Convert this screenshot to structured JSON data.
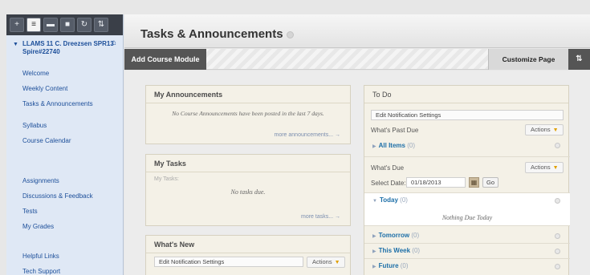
{
  "sidebar": {
    "toolbar_icons": [
      "plus-icon",
      "list-icon",
      "folder-icon",
      "card-icon",
      "refresh-icon",
      "sort-icon"
    ],
    "toolbar_glyphs": [
      "+",
      "≡",
      "▬",
      "■",
      "↻",
      "⇅"
    ],
    "course_title": "LLAMS 11 C. Dreezsen SPR13 Spire#22740",
    "items": [
      {
        "label": "Welcome"
      },
      {
        "label": "Weekly Content"
      },
      {
        "label": "Tasks & Announcements"
      },
      {
        "label": "Syllabus"
      },
      {
        "label": "Course Calendar"
      },
      {
        "label": "Assignments"
      },
      {
        "label": "Discussions & Feedback"
      },
      {
        "label": "Tests"
      },
      {
        "label": "My Grades"
      },
      {
        "label": "Helpful Links"
      },
      {
        "label": "Tech Support"
      }
    ]
  },
  "header": {
    "title": "Tasks & Announcements"
  },
  "actionbar": {
    "add_module": "Add Course Module",
    "customize": "Customize Page",
    "sort": "⇅"
  },
  "announcements": {
    "title": "My Announcements",
    "message": "No Course Announcements have been posted in the last 7 days.",
    "more": "more announcements... →"
  },
  "tasks": {
    "title": "My Tasks",
    "sub": "My Tasks:",
    "message": "No tasks due.",
    "more": "more tasks... →"
  },
  "whats_new": {
    "title": "What's New",
    "edit": "Edit Notification Settings",
    "actions": "Actions"
  },
  "todo": {
    "title": "To Do",
    "edit": "Edit Notification Settings",
    "past_due": "What's Past Due",
    "actions": "Actions",
    "all_items": "All Items",
    "all_items_count": "(0)",
    "whats_due": "What's Due",
    "select_date_label": "Select Date:",
    "select_date_value": "01/18/2013",
    "go": "Go",
    "today": "Today",
    "today_count": "(0)",
    "nothing_due": "Nothing Due Today",
    "tomorrow": "Tomorrow",
    "tomorrow_count": "(0)",
    "this_week": "This Week",
    "this_week_count": "(0)",
    "future": "Future",
    "future_count": "(0)"
  }
}
